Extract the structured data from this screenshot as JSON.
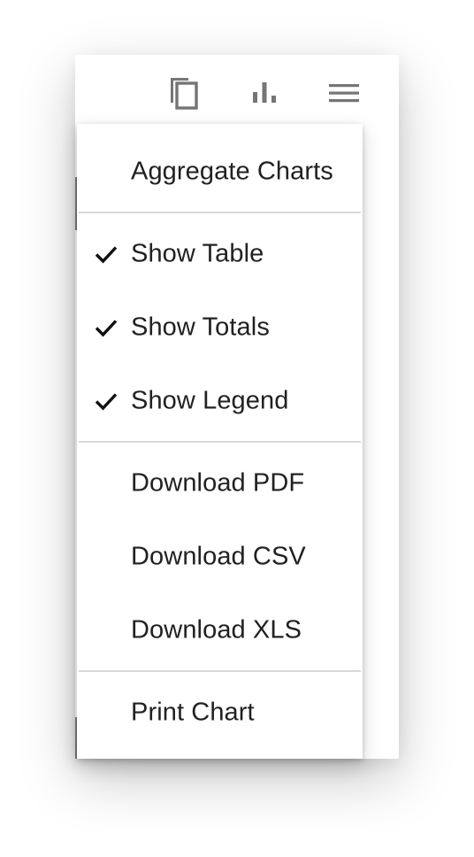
{
  "toolbar": {
    "buttons": [
      {
        "icon": "copy-icon"
      },
      {
        "icon": "bar-chart-icon"
      },
      {
        "icon": "menu-icon"
      }
    ],
    "icon_color": "#757575"
  },
  "menu": {
    "groups": [
      [
        {
          "label": "Aggregate Charts",
          "checked": false
        }
      ],
      [
        {
          "label": "Show Table",
          "checked": true
        },
        {
          "label": "Show Totals",
          "checked": true
        },
        {
          "label": "Show Legend",
          "checked": true
        }
      ],
      [
        {
          "label": "Download PDF",
          "checked": false
        },
        {
          "label": "Download CSV",
          "checked": false
        },
        {
          "label": "Download XLS",
          "checked": false
        }
      ],
      [
        {
          "label": "Print Chart",
          "checked": false
        }
      ]
    ]
  }
}
